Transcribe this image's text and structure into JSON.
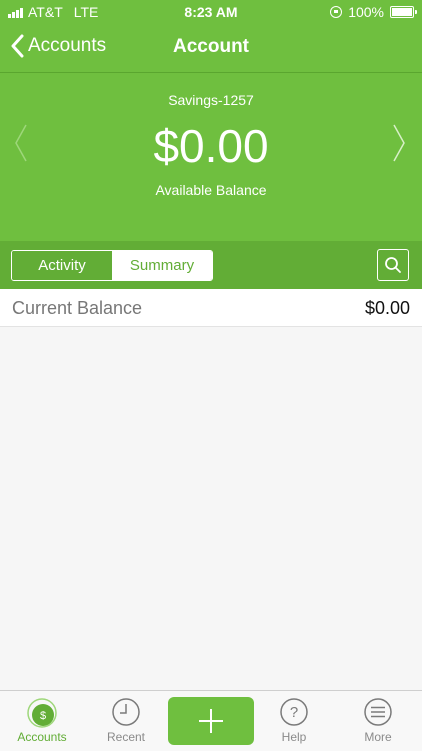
{
  "status_bar": {
    "carrier": "AT&T",
    "network": "LTE",
    "time": "8:23 AM",
    "battery": "100%"
  },
  "nav": {
    "back_label": "Accounts",
    "title": "Account"
  },
  "account": {
    "name": "Savings-1257",
    "balance": "$0.00",
    "balance_label": "Available Balance"
  },
  "segments": {
    "activity": "Activity",
    "summary": "Summary",
    "selected": "Summary"
  },
  "summary_rows": [
    {
      "label": "Current Balance",
      "value": "$0.00"
    }
  ],
  "tab_bar": {
    "items": [
      {
        "label": "Accounts",
        "icon": "dollar-circle-icon",
        "active": true
      },
      {
        "label": "Recent",
        "icon": "clock-icon",
        "active": false
      },
      {
        "label": "",
        "icon": "plus-icon",
        "active": false
      },
      {
        "label": "Help",
        "icon": "question-icon",
        "active": false
      },
      {
        "label": "More",
        "icon": "menu-icon",
        "active": false
      }
    ]
  },
  "colors": {
    "brand_green": "#6fbf3f",
    "segment_green": "#62ad36"
  }
}
